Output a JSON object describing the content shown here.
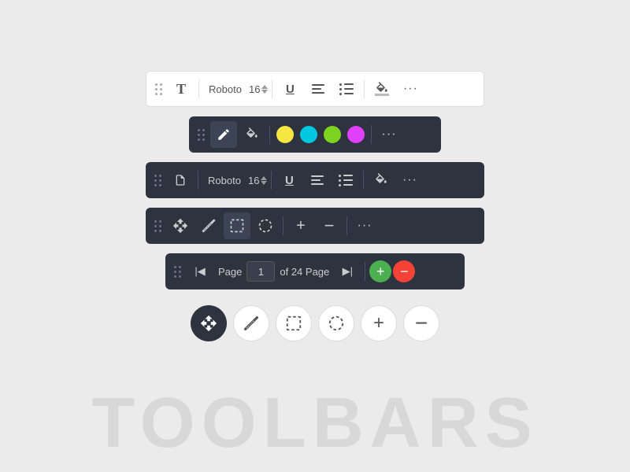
{
  "page": {
    "background": "#ebebeb",
    "watermark": "TOOLBARS"
  },
  "toolbar1": {
    "type": "text-light",
    "font": "Roboto",
    "size": "16",
    "buttons": [
      "T",
      "font",
      "size",
      "underline",
      "align",
      "list",
      "fill",
      "more"
    ]
  },
  "toolbar2": {
    "type": "annotation-dark",
    "colors": [
      "#f5e642",
      "#00c8e0",
      "#7ed321",
      "#e040fb"
    ],
    "buttons": [
      "drag",
      "pencil",
      "fill",
      "colors",
      "more"
    ]
  },
  "toolbar3": {
    "type": "text-dark",
    "font": "Roboto",
    "size": "16",
    "buttons": [
      "drag",
      "doc",
      "font",
      "size",
      "underline",
      "align",
      "list",
      "fill",
      "more"
    ]
  },
  "toolbar4": {
    "type": "object-dark",
    "buttons": [
      "drag",
      "move",
      "ruler",
      "select-rect",
      "select-circle",
      "plus",
      "minus",
      "more"
    ]
  },
  "toolbar5": {
    "type": "page-dark",
    "page_label": "Page",
    "page_current": "1",
    "page_total": "of 24",
    "page_suffix": "Page",
    "buttons": [
      "drag",
      "first",
      "page-text",
      "page-input",
      "page-of",
      "last",
      "zoom-in",
      "zoom-out"
    ]
  },
  "floating": {
    "buttons": [
      "move-dark",
      "ruler-light",
      "select-rect-light",
      "select-circle-light",
      "plus-light",
      "minus-light"
    ]
  },
  "labels": {
    "page": "Page",
    "of24": "of 24",
    "font_roboto": "Roboto",
    "size_16": "16"
  }
}
